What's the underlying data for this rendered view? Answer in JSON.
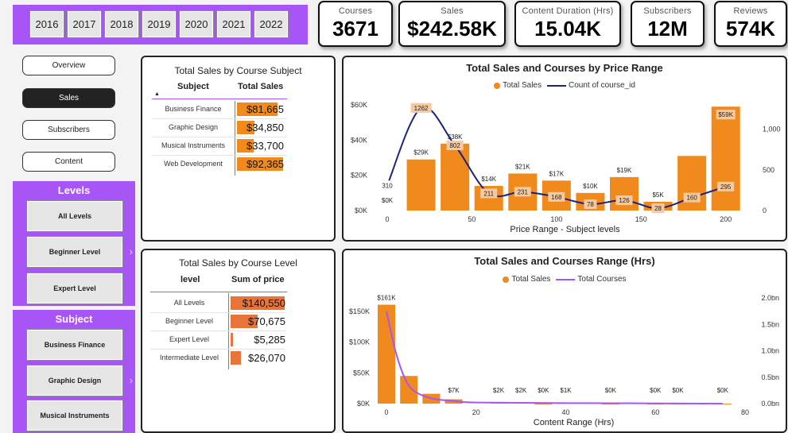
{
  "years": [
    "2016",
    "2017",
    "2018",
    "2019",
    "2020",
    "2021",
    "2022"
  ],
  "kpis": [
    {
      "label": "Courses",
      "value": "3671"
    },
    {
      "label": "Sales",
      "value": "$242.58K"
    },
    {
      "label": "Content Duration (Hrs)",
      "value": "15.04K"
    },
    {
      "label": "Subscribers",
      "value": "12M"
    },
    {
      "label": "Reviews",
      "value": "574K"
    }
  ],
  "nav": [
    "Overview",
    "Sales",
    "Subscribers",
    "Content"
  ],
  "nav_active": "Sales",
  "levels": {
    "title": "Levels",
    "options": [
      "All Levels",
      "Beginner Level",
      "Expert Level"
    ]
  },
  "subject": {
    "title": "Subject",
    "options": [
      "Business Finance",
      "Graphic Design",
      "Musical Instruments"
    ]
  },
  "subject_table": {
    "title": "Total Sales by Course Subject",
    "col1": "Subject",
    "col2": "Total Sales",
    "rows": [
      {
        "label": "Business Finance",
        "value": "$81,665",
        "num": 81665
      },
      {
        "label": "Graphic Design",
        "value": "$34,850",
        "num": 34850
      },
      {
        "label": "Musical Instruments",
        "value": "$33,700",
        "num": 33700
      },
      {
        "label": "Web Development",
        "value": "$92,365",
        "num": 92365
      }
    ],
    "bar_color": "#f08a1c"
  },
  "level_table": {
    "title": "Total Sales by Course Level",
    "col1": "level",
    "col2": "Sum of price",
    "rows": [
      {
        "label": "All Levels",
        "value": "$140,550",
        "num": 140550
      },
      {
        "label": "Beginner Level",
        "value": "$70,675",
        "num": 70675
      },
      {
        "label": "Expert Level",
        "value": "$5,285",
        "num": 5285
      },
      {
        "label": "Intermediate Level",
        "value": "$26,070",
        "num": 26070
      }
    ],
    "bar_color": "#e8743a"
  },
  "chart_data": [
    {
      "type": "bar",
      "title": "Total Sales and Courses by Price Range",
      "xlabel": "Price Range - Subject levels",
      "legend": [
        "Total Sales",
        "Count of course_id"
      ],
      "x_ticks": [
        "0",
        "50",
        "100",
        "150",
        "200"
      ],
      "y_ticks": [
        "$0K",
        "$20K",
        "$40K",
        "$60K"
      ],
      "y2_ticks": [
        "0",
        "500",
        "1,000"
      ],
      "xlim": [
        0,
        210
      ],
      "ylim": [
        0,
        60000
      ],
      "y2lim": [
        0,
        1300
      ],
      "bars": [
        {
          "x": 20,
          "value": 29000,
          "label": "$29K"
        },
        {
          "x": 40,
          "value": 38000,
          "label": "$38K"
        },
        {
          "x": 60,
          "value": 14000,
          "label": "$14K"
        },
        {
          "x": 80,
          "value": 21000,
          "label": "$21K"
        },
        {
          "x": 100,
          "value": 17000,
          "label": "$17K"
        },
        {
          "x": 120,
          "value": 10000,
          "label": "$10K"
        },
        {
          "x": 140,
          "value": 19000,
          "label": "$19K"
        },
        {
          "x": 160,
          "value": 5000,
          "label": "$5K"
        },
        {
          "x": 180,
          "value": 31000,
          "label": ""
        },
        {
          "x": 200,
          "value": 59000,
          "label": "$59K"
        }
      ],
      "zero_label": {
        "x": 0,
        "label": "$0K"
      },
      "line": [
        {
          "x": 0,
          "value": 310,
          "label": "310"
        },
        {
          "x": 20,
          "value": 1262,
          "label": "1262"
        },
        {
          "x": 40,
          "value": 802,
          "label": "802"
        },
        {
          "x": 60,
          "value": 211,
          "label": "211"
        },
        {
          "x": 80,
          "value": 231,
          "label": "231"
        },
        {
          "x": 100,
          "value": 168,
          "label": "168"
        },
        {
          "x": 120,
          "value": 78,
          "label": "78"
        },
        {
          "x": 140,
          "value": 126,
          "label": "126"
        },
        {
          "x": 160,
          "value": 28,
          "label": "28"
        },
        {
          "x": 180,
          "value": 160,
          "label": "160"
        },
        {
          "x": 200,
          "value": 295,
          "label": "295"
        }
      ],
      "bar_color": "#f08a1c",
      "line_color": "#1a237e"
    },
    {
      "type": "bar",
      "title": "Total Sales and Courses Range (Hrs)",
      "xlabel": "Content Range (Hrs)",
      "legend": [
        "Total Sales",
        "Total Courses"
      ],
      "x_ticks": [
        "0",
        "20",
        "40",
        "60",
        "80"
      ],
      "y_ticks": [
        "$0K",
        "$50K",
        "$100K",
        "$150K"
      ],
      "y2_ticks": [
        "0.0bn",
        "0.5bn",
        "1.0bn",
        "1.5bn",
        "2.0bn"
      ],
      "xlim": [
        -2,
        80
      ],
      "ylim": [
        0,
        160000
      ],
      "y2lim": [
        0,
        2.0
      ],
      "bars": [
        {
          "x": 0,
          "value": 161000,
          "label": "$161K"
        },
        {
          "x": 5,
          "value": 45000,
          "label": ""
        },
        {
          "x": 10,
          "value": 16000,
          "label": ""
        },
        {
          "x": 15,
          "value": 7000,
          "label": "$7K"
        },
        {
          "x": 25,
          "value": 2000,
          "label": "$2K"
        },
        {
          "x": 30,
          "value": 2000,
          "label": "$2K"
        },
        {
          "x": 35,
          "value": 0,
          "label": "$0K"
        },
        {
          "x": 40,
          "value": 1000,
          "label": "$1K"
        },
        {
          "x": 50,
          "value": 0,
          "label": "$0K"
        },
        {
          "x": 60,
          "value": 0,
          "label": "$0K"
        },
        {
          "x": 65,
          "value": 0,
          "label": "$0K"
        },
        {
          "x": 75,
          "value": 0,
          "label": "$0K"
        }
      ],
      "line": [
        {
          "x": 0,
          "value": 1.75
        },
        {
          "x": 2,
          "value": 1.0
        },
        {
          "x": 4,
          "value": 0.5
        },
        {
          "x": 6,
          "value": 0.25
        },
        {
          "x": 10,
          "value": 0.1
        },
        {
          "x": 15,
          "value": 0.05
        },
        {
          "x": 20,
          "value": 0.02
        },
        {
          "x": 40,
          "value": 0.01
        },
        {
          "x": 75,
          "value": 0.0
        }
      ],
      "bar_color": "#f08a1c",
      "line_color": "#a855f7"
    }
  ]
}
